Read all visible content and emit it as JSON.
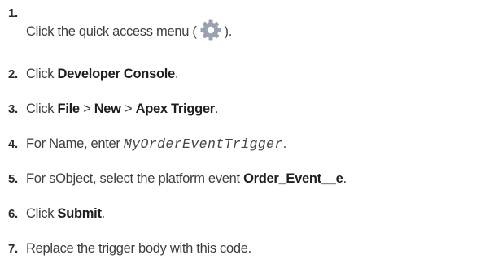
{
  "steps": [
    {
      "number": "1.",
      "pre": "Click the quick access menu (",
      "icon": "gear-icon",
      "post": ")."
    },
    {
      "number": "2.",
      "pre": "Click ",
      "bold": "Developer Console",
      "post": "."
    },
    {
      "number": "3.",
      "pre": "Click ",
      "bold1": "File",
      "sep1": " > ",
      "bold2": "New",
      "sep2": " > ",
      "bold3": "Apex Trigger",
      "post": "."
    },
    {
      "number": "4.",
      "pre": "For Name, enter ",
      "code": "MyOrderEventTrigger",
      "post": "."
    },
    {
      "number": "5.",
      "pre": "For sObject, select the platform event ",
      "bold": "Order_Event__e",
      "post": "."
    },
    {
      "number": "6.",
      "pre": "Click ",
      "bold": "Submit",
      "post": "."
    },
    {
      "number": "7.",
      "pre": "Replace the trigger body with this code."
    }
  ],
  "colors": {
    "gear": "#9aa3ad",
    "gear_hole": "#ffffff",
    "text": "#3e3e3c"
  }
}
